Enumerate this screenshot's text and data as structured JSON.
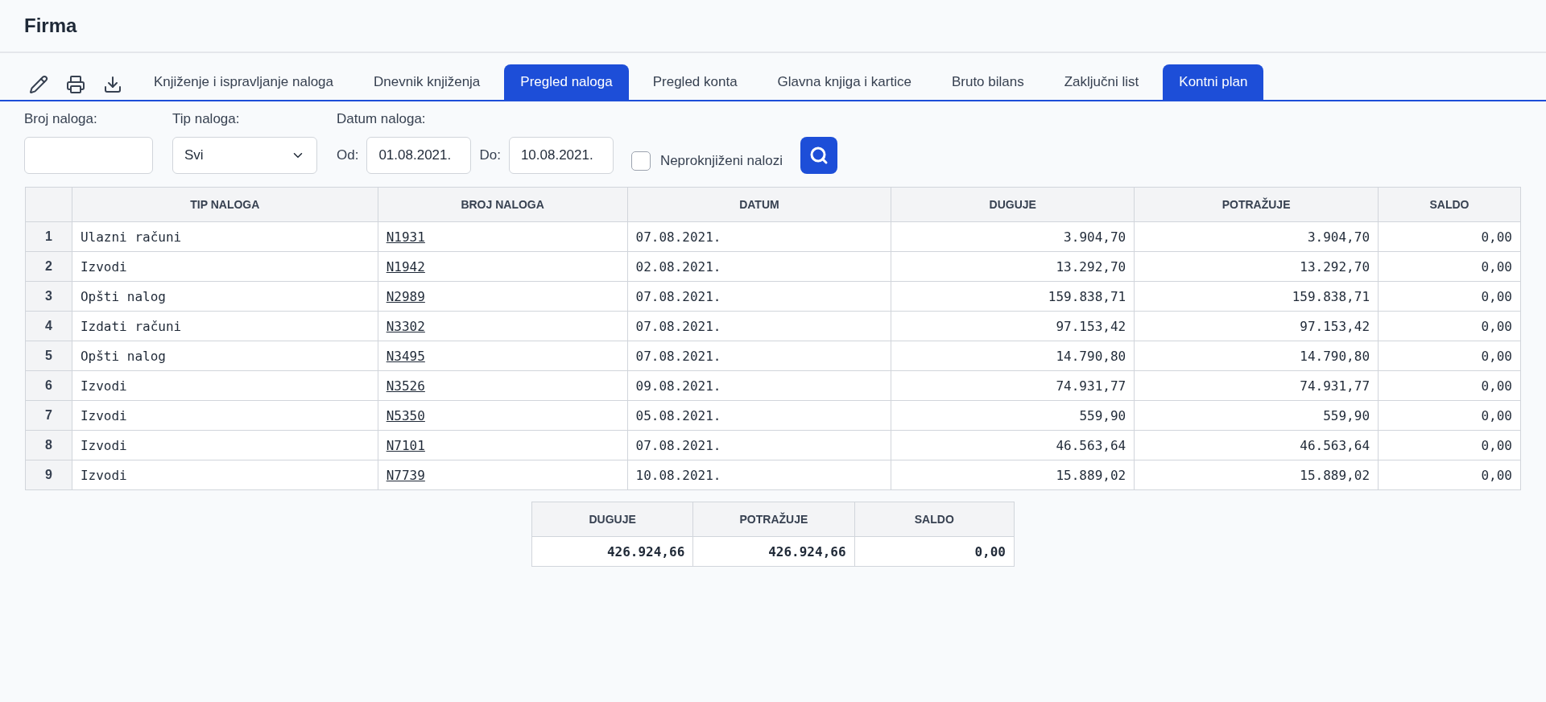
{
  "header": {
    "title": "Firma"
  },
  "toolbar": {
    "tabs": [
      {
        "label": "Knjiženje i ispravljanje naloga",
        "selected": false
      },
      {
        "label": "Dnevnik knjiženja",
        "selected": false
      },
      {
        "label": "Pregled naloga",
        "selected": true
      },
      {
        "label": "Pregled konta",
        "selected": false
      },
      {
        "label": "Glavna knjiga i kartice",
        "selected": false
      },
      {
        "label": "Bruto bilans",
        "selected": false
      },
      {
        "label": "Zaključni list",
        "selected": false
      },
      {
        "label": "Kontni plan",
        "selected": true
      }
    ]
  },
  "filters": {
    "broj_naloga": {
      "label": "Broj naloga:"
    },
    "tip_naloga": {
      "label": "Tip naloga:",
      "value": "Svi"
    },
    "datum_naloga": {
      "label": "Datum naloga:",
      "from_label": "Od:",
      "from": "01.08.2021.",
      "to_label": "Do:",
      "to": "10.08.2021."
    },
    "neproknjizeni": {
      "label": "Neproknjiženi nalozi",
      "checked": false
    }
  },
  "table": {
    "columns": [
      "",
      "TIP NALOGA",
      "BROJ NALOGA",
      "DATUM",
      "DUGUJE",
      "POTRAŽUJE",
      "SALDO"
    ],
    "rows": [
      [
        "1",
        "Ulazni računi",
        "N1931",
        "07.08.2021.",
        "3.904,70",
        "3.904,70",
        "0,00"
      ],
      [
        "2",
        "Izvodi",
        "N1942",
        "02.08.2021.",
        "13.292,70",
        "13.292,70",
        "0,00"
      ],
      [
        "3",
        "Opšti nalog",
        "N2989",
        "07.08.2021.",
        "159.838,71",
        "159.838,71",
        "0,00"
      ],
      [
        "4",
        "Izdati računi",
        "N3302",
        "07.08.2021.",
        "97.153,42",
        "97.153,42",
        "0,00"
      ],
      [
        "5",
        "Opšti nalog",
        "N3495",
        "07.08.2021.",
        "14.790,80",
        "14.790,80",
        "0,00"
      ],
      [
        "6",
        "Izvodi",
        "N3526",
        "09.08.2021.",
        "74.931,77",
        "74.931,77",
        "0,00"
      ],
      [
        "7",
        "Izvodi",
        "N5350",
        "05.08.2021.",
        "559,90",
        "559,90",
        "0,00"
      ],
      [
        "8",
        "Izvodi",
        "N7101",
        "07.08.2021.",
        "46.563,64",
        "46.563,64",
        "0,00"
      ],
      [
        "9",
        "Izvodi",
        "N7739",
        "10.08.2021.",
        "15.889,02",
        "15.889,02",
        "0,00"
      ]
    ]
  },
  "totals": {
    "columns": [
      "DUGUJE",
      "POTRAŽUJE",
      "SALDO"
    ],
    "values": [
      "426.924,66",
      "426.924,66",
      "0,00"
    ]
  }
}
